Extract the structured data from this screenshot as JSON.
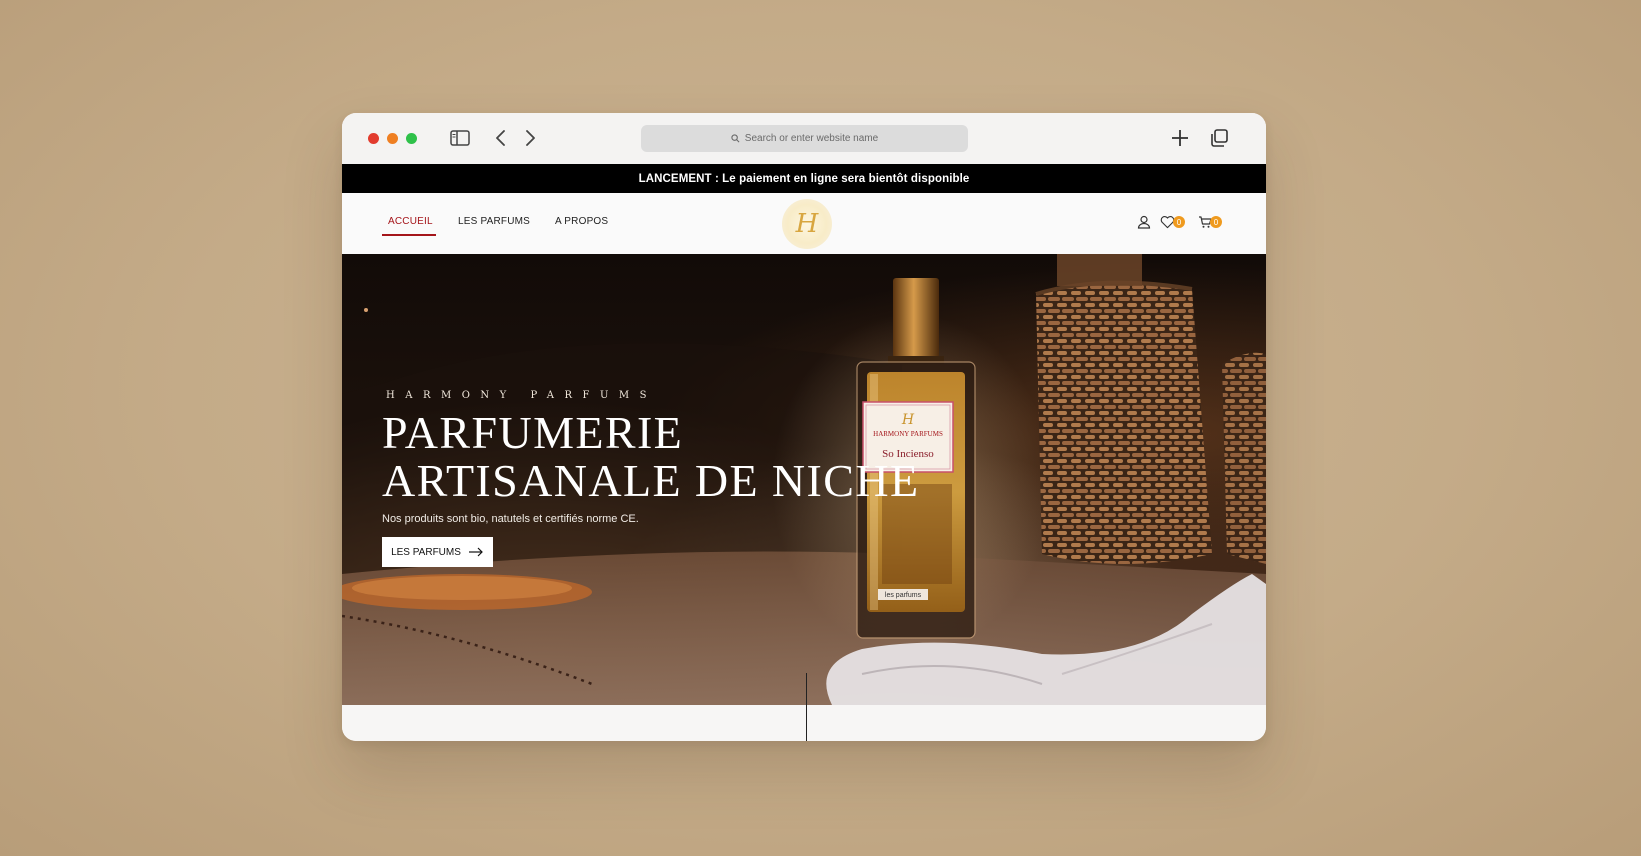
{
  "browser": {
    "url_placeholder": "Search or enter website name",
    "icons": [
      "sidebar-icon",
      "back-icon",
      "forward-icon",
      "search-icon",
      "new-tab-icon",
      "tabs-overview-icon"
    ],
    "traffic_lights": [
      "#e23b2e",
      "#ef7f22",
      "#2fc14a"
    ]
  },
  "announcement": {
    "text": "LANCEMENT : Le paiement en ligne sera bientôt disponible"
  },
  "nav": {
    "items": [
      {
        "label": "ACCUEIL",
        "active": true
      },
      {
        "label": "LES PARFUMS",
        "active": false
      },
      {
        "label": "A PROPOS",
        "active": false
      }
    ],
    "logo_text": "H",
    "wishlist_count": "0",
    "cart_count": "0",
    "accent_color": "#a4151a",
    "badge_color": "#ef9a1e"
  },
  "hero": {
    "brand": "HARMONY PARFUMS",
    "title_line1": "Parfumerie",
    "title_line2": "artisanale de niche",
    "subtitle": "Nos produits sont bio, natutels et certifiés norme CE.",
    "button_label": "LES PARFUMS",
    "bottle_label_brand": "HARMONY PARFUMS",
    "bottle_label_name": "So Incienso",
    "bottle_tag": "les parfums"
  }
}
